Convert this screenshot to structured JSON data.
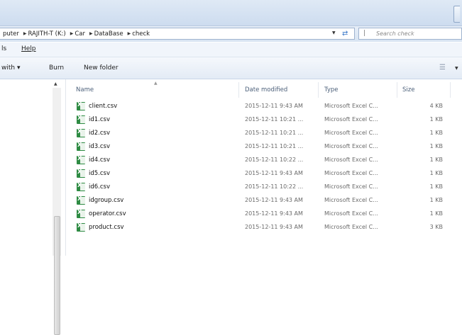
{
  "address": {
    "crumbs": [
      "puter",
      "RAJITH-T (K:)",
      "Car",
      "DataBase",
      "check"
    ],
    "search_placeholder": "Search check"
  },
  "menu": {
    "tools": "ls",
    "help": "Help"
  },
  "toolbar": {
    "share": "with ▾",
    "burn": "Burn",
    "new_folder": "New folder"
  },
  "columns": {
    "name": "Name",
    "date": "Date modified",
    "type": "Type",
    "size": "Size"
  },
  "files": [
    {
      "name": "client.csv",
      "date": "2015-12-11 9:43 AM",
      "type": "Microsoft Excel C...",
      "size": "4 KB"
    },
    {
      "name": "id1.csv",
      "date": "2015-12-11 10:21 ...",
      "type": "Microsoft Excel C...",
      "size": "1 KB"
    },
    {
      "name": "id2.csv",
      "date": "2015-12-11 10:21 ...",
      "type": "Microsoft Excel C...",
      "size": "1 KB"
    },
    {
      "name": "id3.csv",
      "date": "2015-12-11 10:21 ...",
      "type": "Microsoft Excel C...",
      "size": "1 KB"
    },
    {
      "name": "id4.csv",
      "date": "2015-12-11 10:22 ...",
      "type": "Microsoft Excel C...",
      "size": "1 KB"
    },
    {
      "name": "id5.csv",
      "date": "2015-12-11 9:43 AM",
      "type": "Microsoft Excel C...",
      "size": "1 KB"
    },
    {
      "name": "id6.csv",
      "date": "2015-12-11 10:22 ...",
      "type": "Microsoft Excel C...",
      "size": "1 KB"
    },
    {
      "name": "idgroup.csv",
      "date": "2015-12-11 9:43 AM",
      "type": "Microsoft Excel C...",
      "size": "1 KB"
    },
    {
      "name": "operator.csv",
      "date": "2015-12-11 9:43 AM",
      "type": "Microsoft Excel C...",
      "size": "1 KB"
    },
    {
      "name": "product.csv",
      "date": "2015-12-11 9:43 AM",
      "type": "Microsoft Excel C...",
      "size": "3 KB"
    }
  ],
  "icons": {
    "file": "excel-csv-icon",
    "search": "search-icon",
    "refresh": "refresh-icon",
    "view": "view-options-icon"
  },
  "colors": {
    "chrome": "#d8e4f2",
    "header_text": "#4c607a",
    "refresh_blue": "#3a78c9",
    "excel_green": "#2e8b43"
  }
}
